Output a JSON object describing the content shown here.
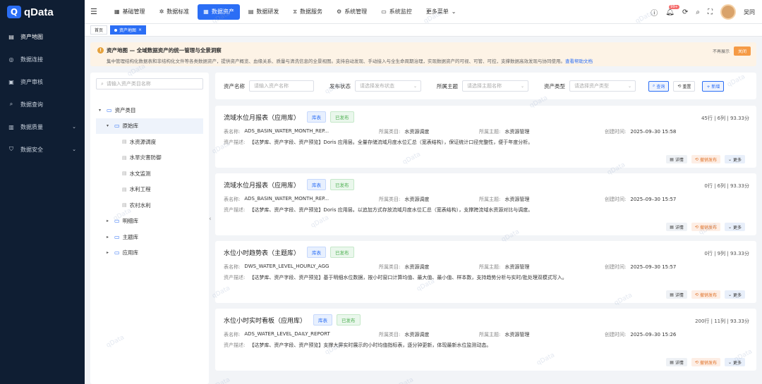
{
  "app": {
    "logo_mark": "Q",
    "logo_text": "qData"
  },
  "sidebar": {
    "items": [
      {
        "label": "资产地图",
        "icon": "map-icon",
        "glyph": "▤",
        "has_arrow": false
      },
      {
        "label": "数据连接",
        "icon": "link-icon",
        "glyph": "◎",
        "has_arrow": false
      },
      {
        "label": "资产审核",
        "icon": "audit-icon",
        "glyph": "▣",
        "has_arrow": false
      },
      {
        "label": "数据查询",
        "icon": "search-icon",
        "glyph": "⌕",
        "has_arrow": false
      },
      {
        "label": "数据质量",
        "icon": "quality-icon",
        "glyph": "▥",
        "has_arrow": true
      },
      {
        "label": "数据安全",
        "icon": "shield-icon",
        "glyph": "⛉",
        "has_arrow": true
      }
    ]
  },
  "topnav": {
    "items": [
      {
        "label": "基础管理",
        "glyph": "▦",
        "active": false
      },
      {
        "label": "数据标准",
        "glyph": "✲",
        "active": false
      },
      {
        "label": "数据资产",
        "glyph": "▦",
        "active": true
      },
      {
        "label": "数据研发",
        "glyph": "▤",
        "active": false
      },
      {
        "label": "数据服务",
        "glyph": "⧖",
        "active": false
      },
      {
        "label": "系统管理",
        "glyph": "⚙",
        "active": false
      },
      {
        "label": "系统监控",
        "glyph": "▭",
        "active": false
      },
      {
        "label": "更多菜单",
        "glyph": "⌄",
        "active": false
      }
    ]
  },
  "header": {
    "badge": "99+",
    "user": "吴同"
  },
  "tabs": [
    {
      "label": "首页",
      "active": false
    },
    {
      "label": "资产地图",
      "active": true,
      "close": "×"
    }
  ],
  "notice": {
    "title": "资产地图 — 全域数据资产的统一管理与全景洞察",
    "desc": "集中管理结构化数据表和非结构化文件等各类数据资产，提供资产概览、血缘关系、质量与清洗信息的全景视图。支持自动发现、手动接入与全生命周期治理，实现数据资产的可视、可管、可控，支撑数据高效发现与协同使用。",
    "link": "查看帮助文档",
    "no_show": "不再展示",
    "close": "关闭"
  },
  "tree": {
    "search_placeholder": "请输入资产类目名称",
    "nodes": [
      {
        "label": "资产类目",
        "level": 0,
        "type": "folder",
        "caret": "▾",
        "sel": false
      },
      {
        "label": "原始库",
        "level": 1,
        "type": "folder",
        "caret": "▾",
        "sel": true
      },
      {
        "label": "水资源调度",
        "level": 2,
        "type": "file",
        "caret": "",
        "sel": false
      },
      {
        "label": "水旱灾害防御",
        "level": 2,
        "type": "file",
        "caret": "",
        "sel": false
      },
      {
        "label": "水文监测",
        "level": 2,
        "type": "file",
        "caret": "",
        "sel": false
      },
      {
        "label": "水利工程",
        "level": 2,
        "type": "file",
        "caret": "",
        "sel": false
      },
      {
        "label": "农村水利",
        "level": 2,
        "type": "file",
        "caret": "",
        "sel": false
      },
      {
        "label": "明细库",
        "level": 1,
        "type": "folder",
        "caret": "▸",
        "sel": false
      },
      {
        "label": "主题库",
        "level": 1,
        "type": "folder",
        "caret": "▸",
        "sel": false
      },
      {
        "label": "应用库",
        "level": 1,
        "type": "folder",
        "caret": "▸",
        "sel": false
      }
    ]
  },
  "filter": {
    "name_label": "资产名称",
    "name_placeholder": "请输入资产名称",
    "status_label": "发布状态",
    "status_placeholder": "请选择发布状态",
    "theme_label": "所属主题",
    "theme_placeholder": "请选择主题名称",
    "type_label": "资产类型",
    "type_placeholder": "请选择资产类型",
    "query": "查询",
    "reset": "重置",
    "add": "+ 新增"
  },
  "card_labels": {
    "table": "表名称:",
    "category": "所属类目:",
    "theme": "所属主题:",
    "created": "创建时间:",
    "desc": "资产描述:",
    "detail": "详情",
    "revoke": "撤销发布",
    "more": "更多"
  },
  "cards": [
    {
      "title": "流域水位月报表（应用库）",
      "tag1": "库表",
      "tag2": "已发布",
      "stats": "45行 | 6列 | 93.33分",
      "table": "ADS_BASIN_WATER_MONTH_REP...",
      "category": "水资源调度",
      "theme": "水资源管理",
      "created": "2025–09–30 15:58",
      "desc": "【达梦库、资产字段、资产预览】Doris 应用层。全量存储流域月度水位汇总（宽表结构），保证统计口径完整性，便于年度分析。"
    },
    {
      "title": "流域水位月报表（应用库）",
      "tag1": "库表",
      "tag2": "已发布",
      "stats": "0行 | 6列 | 93.33分",
      "table": "ADS_BASIN_WATER_MONTH_REP...",
      "category": "水资源调度",
      "theme": "水资源管理",
      "created": "2025–09–30 15:57",
      "desc": "【达梦库、资产字段、资产预览】Doris 应用层。以追加方式存放流域月度水位汇总（宽表结构），支撑跨流域水资源对比与调度。"
    },
    {
      "title": "水位小时趋势表（主题库）",
      "tag1": "库表",
      "tag2": "已发布",
      "stats": "0行 | 9列 | 93.33分",
      "table": "DWS_WATER_LEVEL_HOURLY_AGG",
      "category": "水资源调度",
      "theme": "水资源管理",
      "created": "2025–09–30 15:57",
      "desc": "【达梦库、资产字段、资产预览】基于明细水位数据，按小时窗口计算均值、最大值、最小值、样本数，支持趋势分析与实时/批处理双模式写入。"
    },
    {
      "title": "水位小时实时看板（应用库）",
      "tag1": "库表",
      "tag2": "已发布",
      "stats": "200行 | 11列 | 93.33分",
      "table": "ADS_WATER_LEVEL_DAILY_REPORT",
      "category": "水资源调度",
      "theme": "水资源管理",
      "created": "2025–09–30 15:26",
      "desc": "【达梦库、资产字段、资产预览】支撑大屏实时展示的小时均值指标表，逐分钟更新，体现最新水位监测动态。"
    }
  ],
  "watermark": "qData"
}
